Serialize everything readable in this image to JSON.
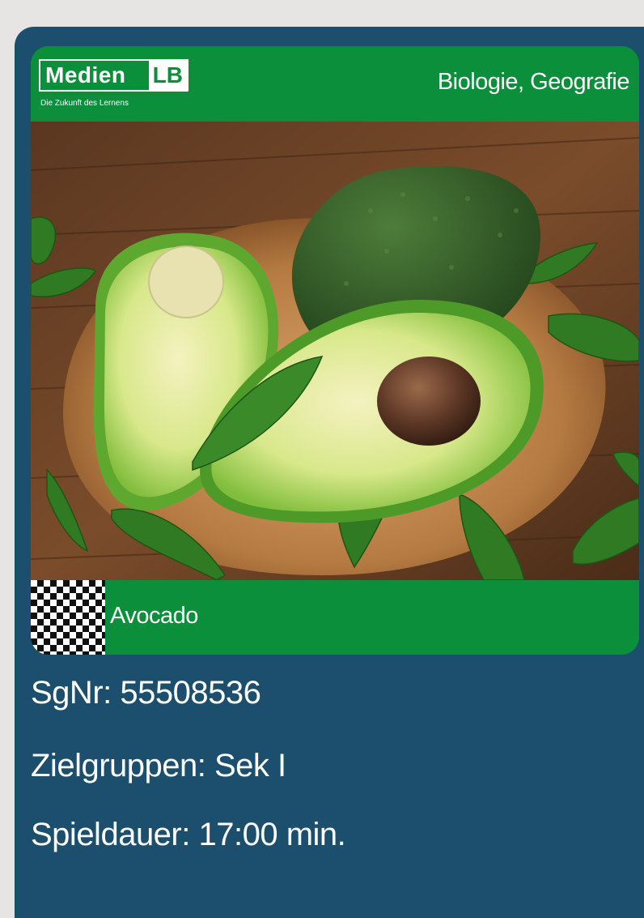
{
  "logo": {
    "name_part": "Medien",
    "suffix": "LB",
    "tagline": "Die Zukunft des Lernens"
  },
  "subject": "Biologie, Geografie",
  "title": "Avocado",
  "details": {
    "sgnr": "SgNr: 55508536",
    "zielgruppen": "Zielgruppen: Sek I",
    "spieldauer": "Spieldauer: 17:00 min."
  },
  "colors": {
    "brand_green": "#0b8f3b",
    "card_blue": "#1c4e6e"
  }
}
